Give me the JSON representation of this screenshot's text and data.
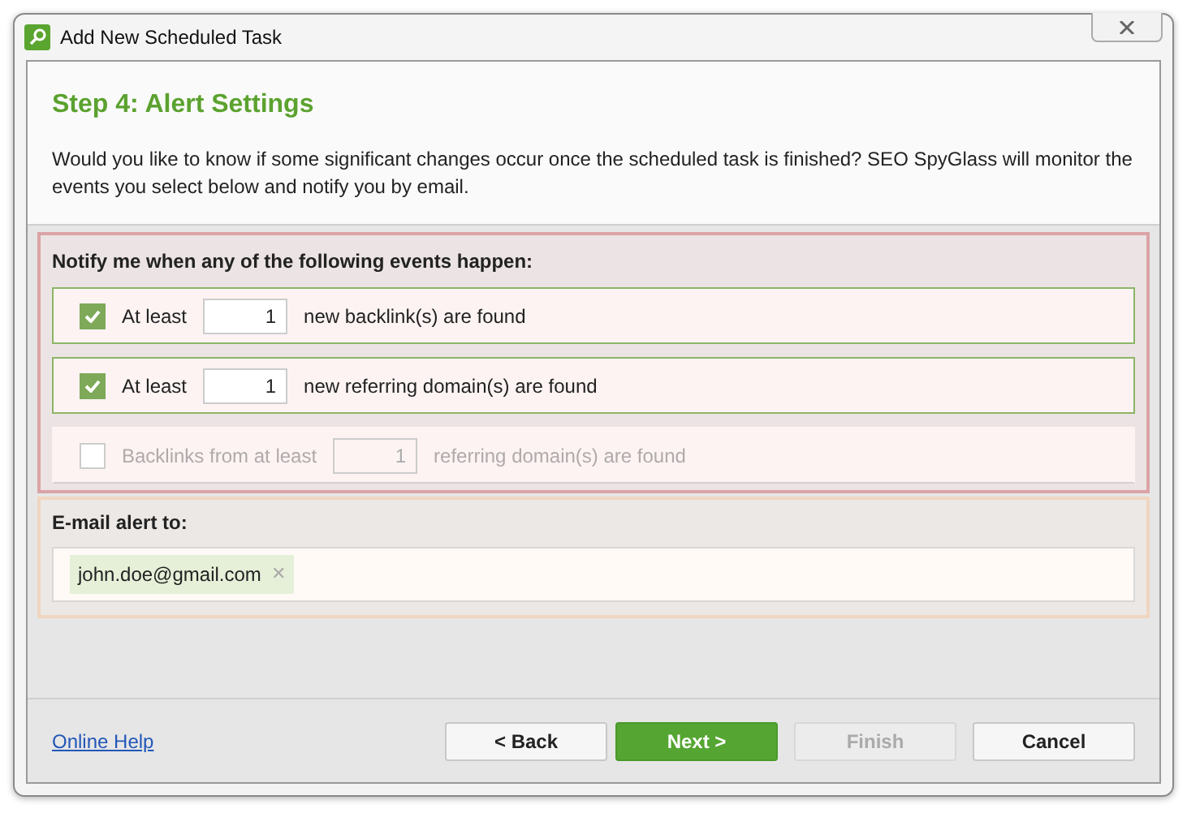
{
  "window": {
    "title": "Add New Scheduled Task"
  },
  "header": {
    "title": "Step 4: Alert Settings",
    "description": "Would you like to know if some significant changes occur once the scheduled task is finished? SEO SpyGlass will monitor the events you select below and notify you by email."
  },
  "events": {
    "heading": "Notify me when any of the following events happen:",
    "items": [
      {
        "kind": "checkbox",
        "checked": true,
        "disabled": false,
        "prefix": "At least",
        "value": "1",
        "suffix": "new backlink(s) are found"
      },
      {
        "kind": "checkbox",
        "checked": true,
        "disabled": false,
        "prefix": "At least",
        "value": "1",
        "suffix": "new referring domain(s) are found"
      },
      {
        "kind": "checkbox",
        "checked": false,
        "disabled": true,
        "prefix": "Backlinks from at least",
        "value": "1",
        "suffix": "referring domain(s) are found"
      }
    ]
  },
  "email": {
    "heading": "E-mail alert to:",
    "recipients": [
      "john.doe@gmail.com"
    ],
    "remove_glyph": "✕"
  },
  "footer": {
    "help_link": "Online Help",
    "buttons": [
      {
        "label": "< Back",
        "kind": "normal",
        "disabled": false
      },
      {
        "label": "Next >",
        "kind": "primary",
        "disabled": false
      },
      {
        "label": "Finish",
        "kind": "normal",
        "disabled": true
      },
      {
        "label": "Cancel",
        "kind": "normal",
        "disabled": false
      }
    ]
  }
}
